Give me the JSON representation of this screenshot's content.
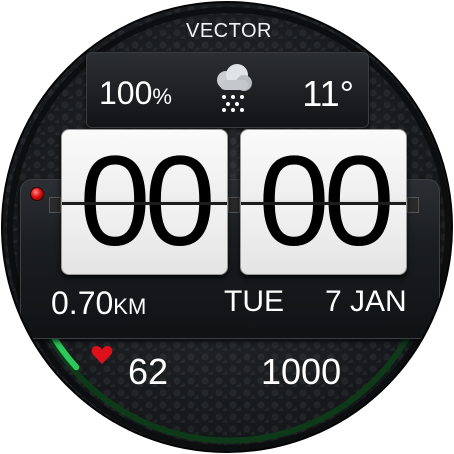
{
  "brand": "VECTOR",
  "status": {
    "battery": "100",
    "battery_unit": "%",
    "temperature": "11°"
  },
  "time": {
    "hours": "00",
    "minutes": "00"
  },
  "date": {
    "day": "TUE",
    "date": "7 JAN"
  },
  "activity": {
    "distance": "0.70",
    "distance_unit": "KM",
    "heart_rate": "62",
    "steps": "1000",
    "step_progress": 0.12
  },
  "icons": {
    "weather": "snow-cloud-icon",
    "heart": "heart-icon",
    "led": "status-led-icon"
  },
  "colors": {
    "progress": "#2cc85a",
    "heart": "#e0101a",
    "led": "#e01010"
  }
}
